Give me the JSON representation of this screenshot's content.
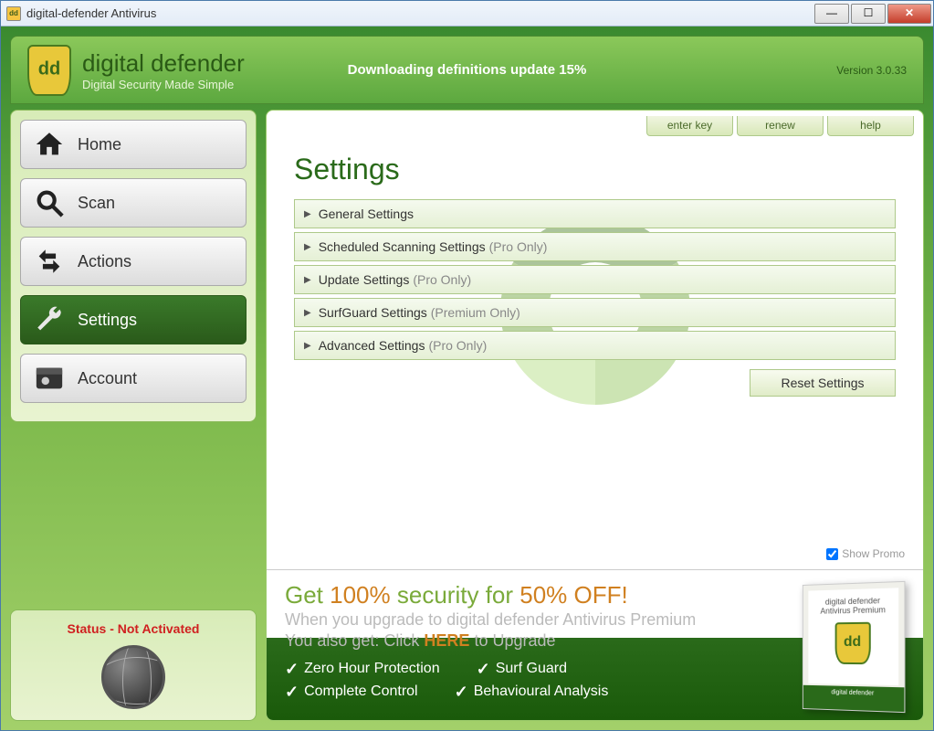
{
  "window": {
    "title": "digital-defender Antivirus"
  },
  "header": {
    "brand": "digital defender",
    "tagline": "Digital Security Made Simple",
    "status": "Downloading definitions update 15%",
    "version": "Version 3.0.33"
  },
  "nav": {
    "items": [
      {
        "label": "Home"
      },
      {
        "label": "Scan"
      },
      {
        "label": "Actions"
      },
      {
        "label": "Settings"
      },
      {
        "label": "Account"
      }
    ]
  },
  "sidebar_status": "Status - Not Activated",
  "top_links": {
    "enter_key": "enter key",
    "renew": "renew",
    "help": "help"
  },
  "main": {
    "title": "Settings",
    "items": [
      {
        "label": "General Settings",
        "suffix": ""
      },
      {
        "label": "Scheduled Scanning Settings",
        "suffix": "(Pro Only)"
      },
      {
        "label": "Update Settings",
        "suffix": "(Pro Only)"
      },
      {
        "label": "SurfGuard Settings",
        "suffix": "(Premium Only)"
      },
      {
        "label": "Advanced Settings",
        "suffix": "(Pro Only)"
      }
    ],
    "reset": "Reset Settings"
  },
  "promo_toggle": "Show Promo",
  "promo": {
    "title_pre": "Get ",
    "title_pct": "100%",
    "title_mid": " security for ",
    "title_pct2": "50% OFF!",
    "sub1": "When you upgrade to digital defender Antivirus Premium",
    "sub2_pre": "You also get:  Click ",
    "sub2_here": "HERE",
    "sub2_post": " to Upgrade",
    "features": [
      "Zero Hour Protection",
      "Surf Guard",
      "Complete Control",
      "Behavioural Analysis"
    ],
    "box_title": "digital defender",
    "box_sub": "Antivirus Premium",
    "box_bottom": "digital defender"
  }
}
